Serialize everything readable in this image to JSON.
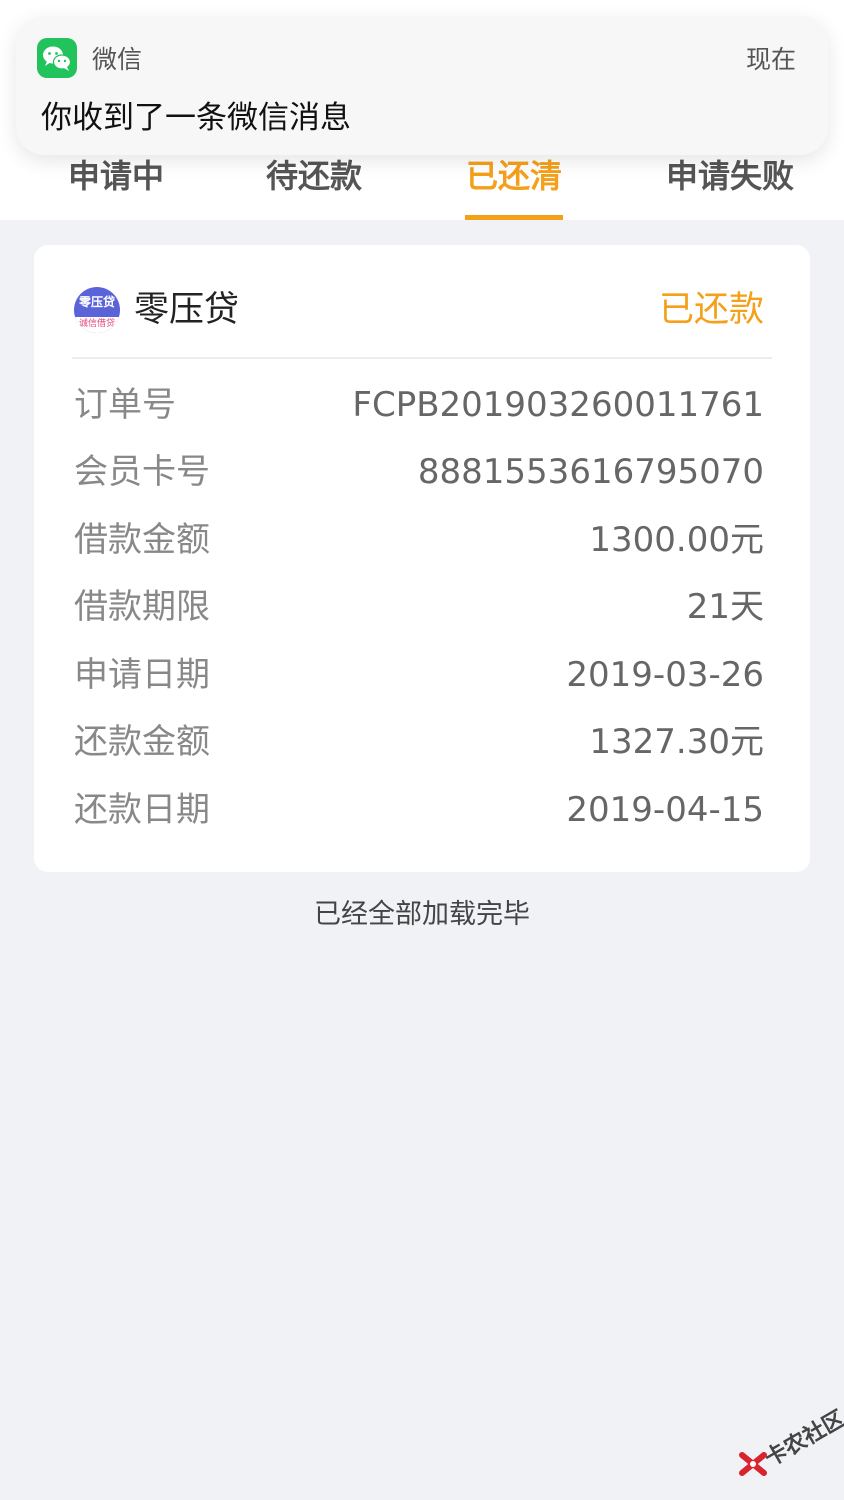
{
  "notification": {
    "app_name": "微信",
    "time": "现在",
    "message": "你收到了一条微信消息",
    "icon": "wechat-icon",
    "icon_color": "#22c25d"
  },
  "tabs": [
    {
      "label": "申请中",
      "active": false
    },
    {
      "label": "待还款",
      "active": false
    },
    {
      "label": "已还清",
      "active": true
    },
    {
      "label": "申请失败",
      "active": false
    }
  ],
  "accent_color": "#f5a01a",
  "card": {
    "lender_name": "零压贷",
    "logo_text_top": "零压贷",
    "logo_text_bottom": "诚信借贷",
    "status": "已还款",
    "rows": [
      {
        "label": "订单号",
        "value": "FCPB201903260011761"
      },
      {
        "label": "会员卡号",
        "value": "8881553616795070"
      },
      {
        "label": "借款金额",
        "value": "1300.00元"
      },
      {
        "label": "借款期限",
        "value": "21天"
      },
      {
        "label": "申请日期",
        "value": "2019-03-26"
      },
      {
        "label": "还款金额",
        "value": "1327.30元"
      },
      {
        "label": "还款日期",
        "value": "2019-04-15"
      }
    ]
  },
  "footer_text": "已经全部加载完毕",
  "watermark_text": "卡农社区"
}
